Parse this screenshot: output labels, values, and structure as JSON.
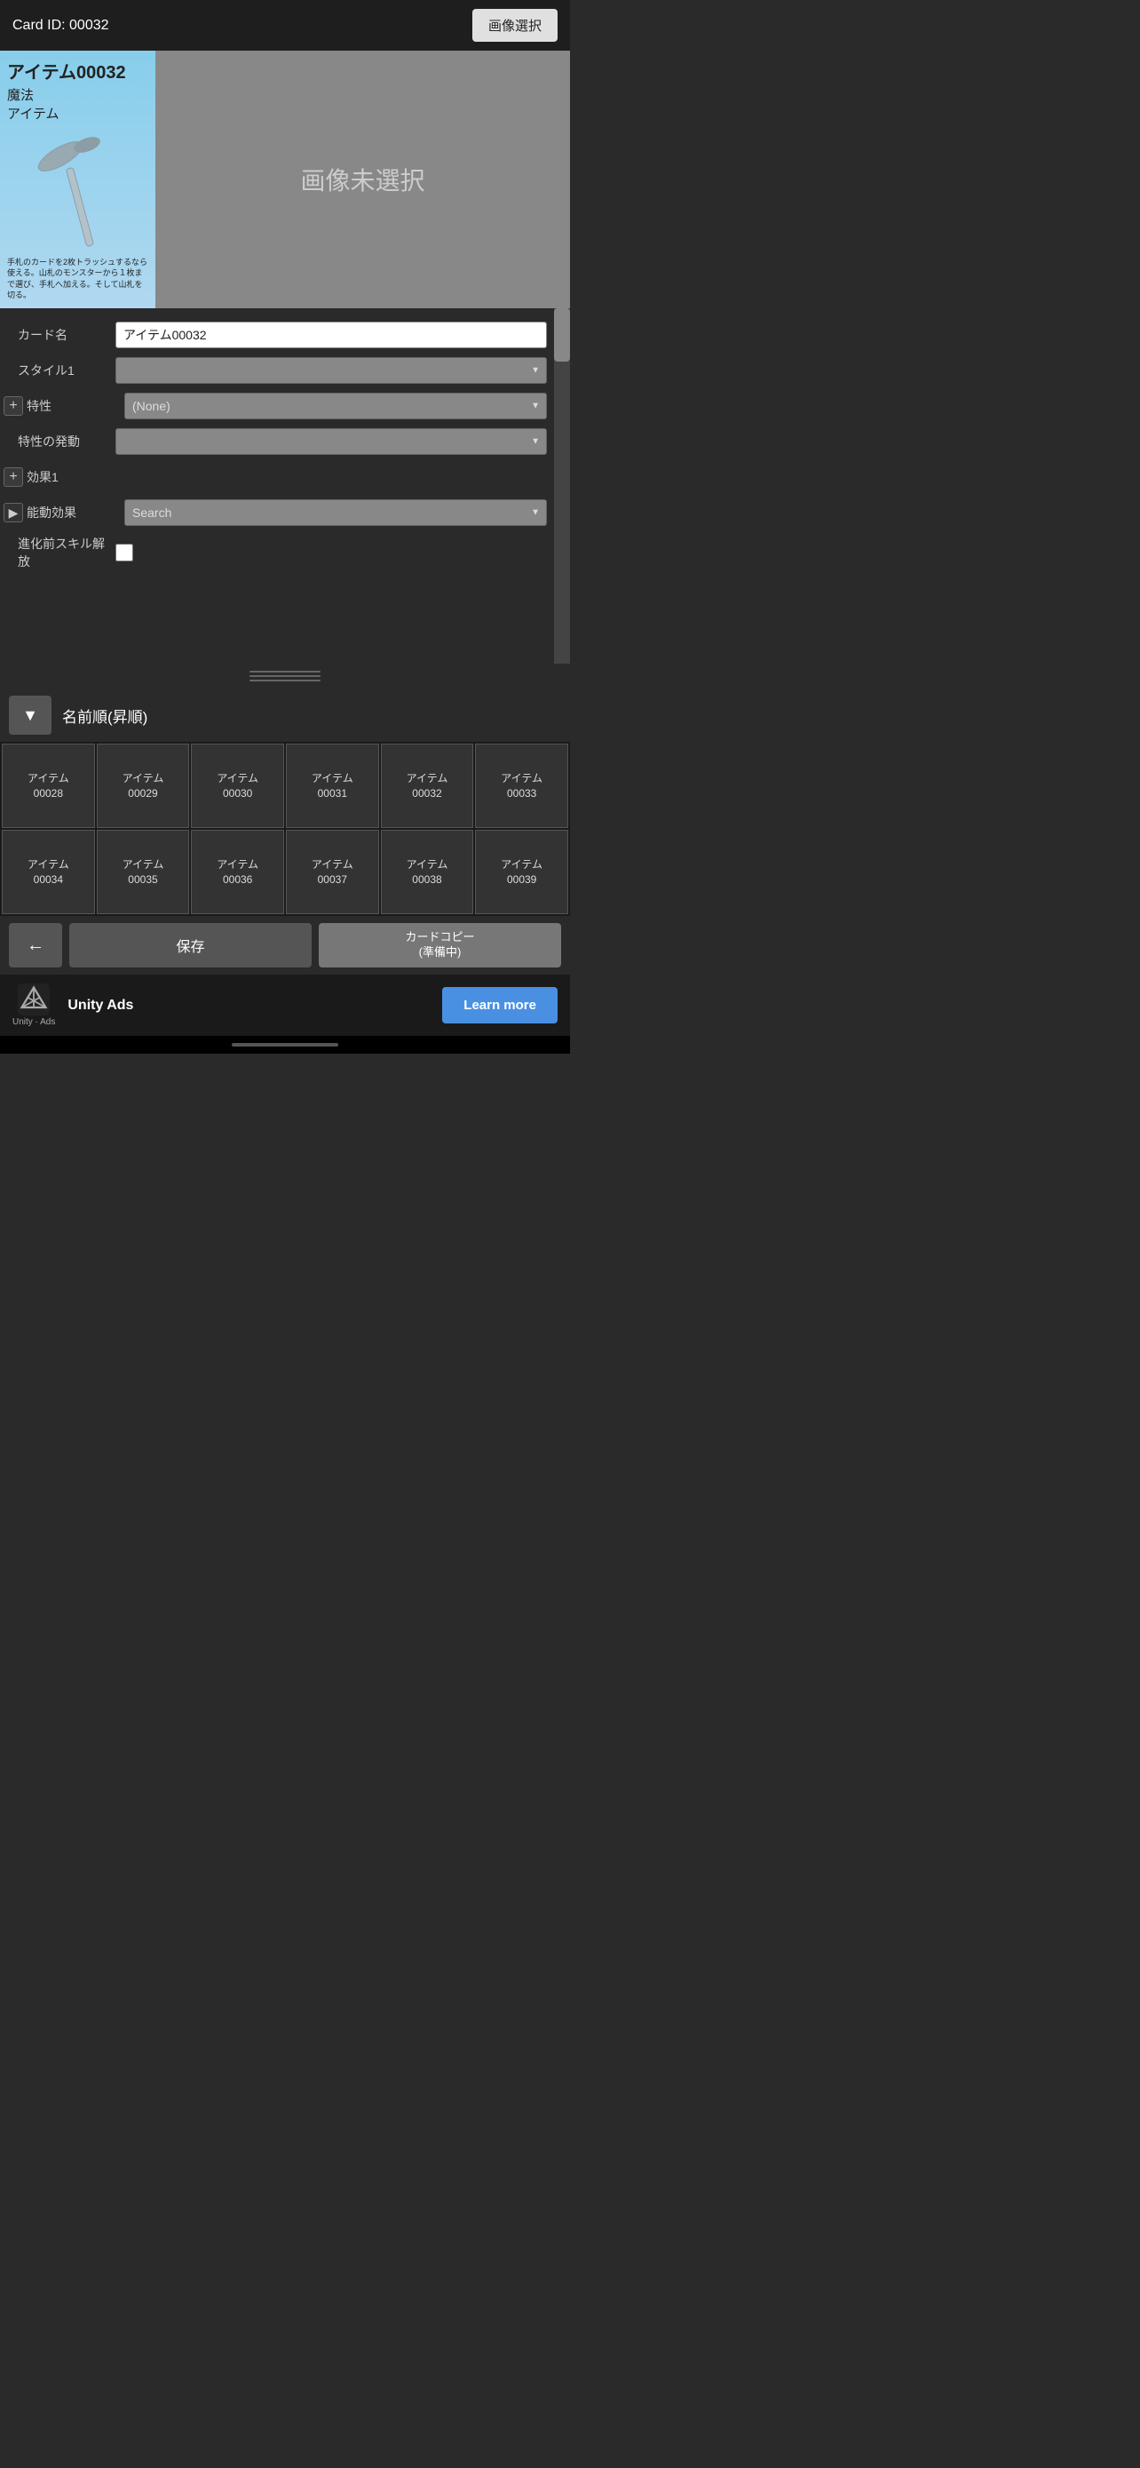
{
  "header": {
    "card_id_label": "Card ID: 00032",
    "image_select_btn": "画像選択"
  },
  "card_preview": {
    "title": "アイテム00032",
    "type_line1": "魔法",
    "type_line2": "アイテム",
    "description": "手札のカードを2枚トラッシュするなら使える。山札のモンスターから１枚まで選び、手札へ加える。そして山札を切る。",
    "no_image_text": "画像未選択"
  },
  "form": {
    "card_name_label": "カード名",
    "card_name_value": "アイテム00032",
    "style1_label": "スタイル1",
    "style1_value": "",
    "trait_label": "特性",
    "trait_value": "(None)",
    "trait_trigger_label": "特性の発動",
    "trait_trigger_value": "",
    "effect1_label": "効果1",
    "active_effect_label": "能動効果",
    "active_effect_placeholder": "Search",
    "skill_release_label": "進化前スキル解放"
  },
  "sort": {
    "sort_label": "名前順(昇順)",
    "sort_btn_icon": "▼"
  },
  "grid_items": [
    {
      "line1": "アイテム",
      "line2": "00028"
    },
    {
      "line1": "アイテム",
      "line2": "00029"
    },
    {
      "line1": "アイテム",
      "line2": "00030"
    },
    {
      "line1": "アイテム",
      "line2": "00031"
    },
    {
      "line1": "アイテム",
      "line2": "00032"
    },
    {
      "line1": "アイテム",
      "line2": "00033"
    },
    {
      "line1": "アイテム",
      "line2": "00034"
    },
    {
      "line1": "アイテム",
      "line2": "00035"
    },
    {
      "line1": "アイテム",
      "line2": "00036"
    },
    {
      "line1": "アイテム",
      "line2": "00037"
    },
    {
      "line1": "アイテム",
      "line2": "00038"
    },
    {
      "line1": "アイテム",
      "line2": "00039"
    }
  ],
  "actions": {
    "back_icon": "←",
    "save_label": "保存",
    "copy_label": "カードコピー\n(準備中)"
  },
  "ad": {
    "brand_name": "Unity Ads",
    "brand_sub": "Unity · Ads",
    "learn_more_label": "Learn more"
  },
  "divider": {
    "lines": 3
  }
}
